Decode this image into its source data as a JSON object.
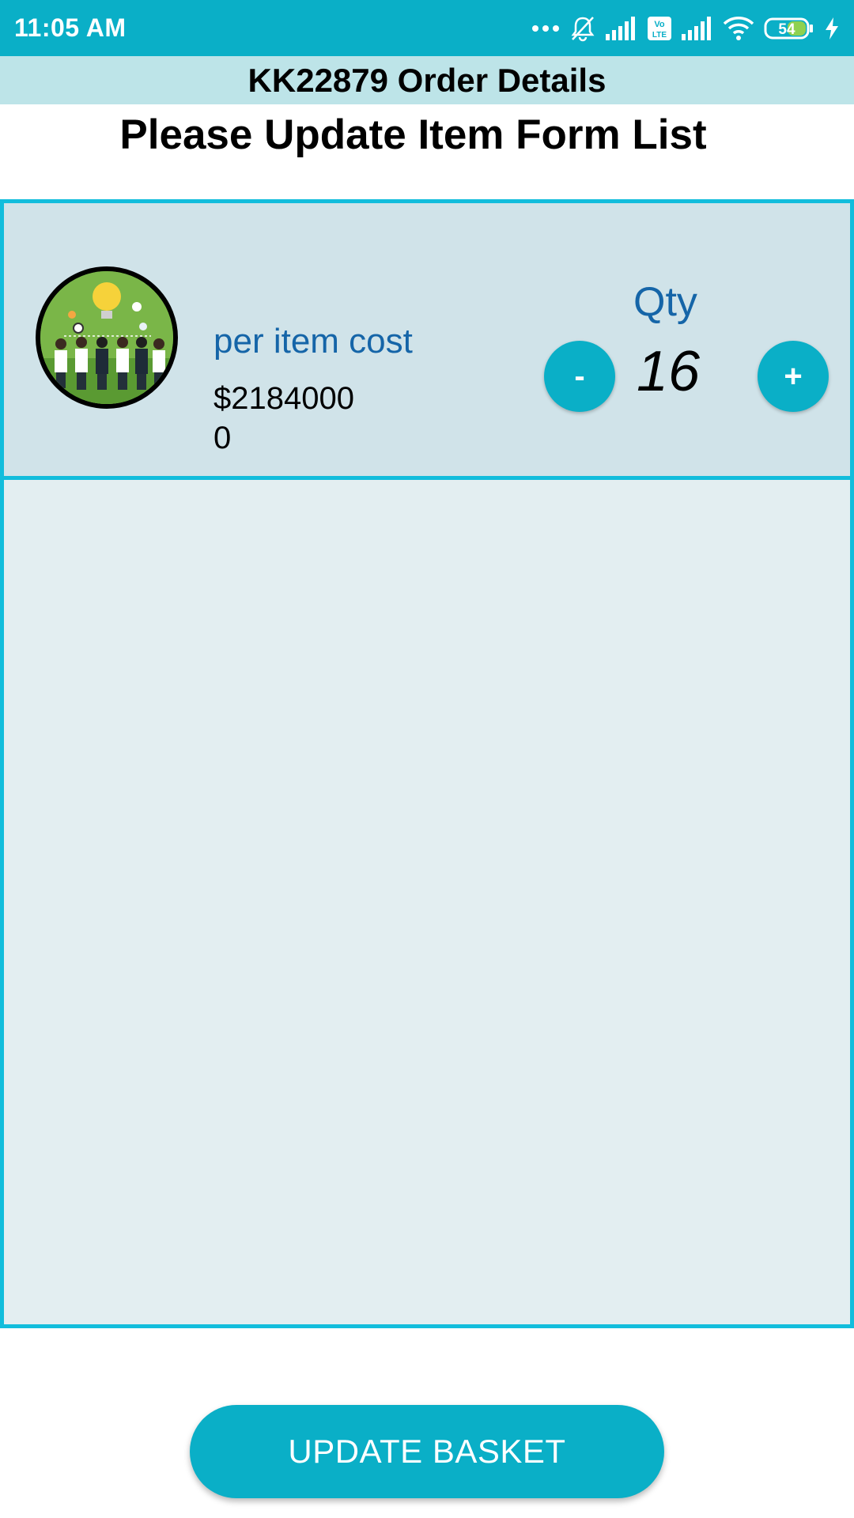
{
  "status_bar": {
    "time": "11:05 AM",
    "battery": "54",
    "icons": [
      "more-dots-icon",
      "bell-muted-icon",
      "signal-icon",
      "volte-icon",
      "signal-icon",
      "wifi-icon",
      "battery-icon",
      "charging-icon"
    ]
  },
  "header": {
    "title": "KK22879 Order Details"
  },
  "page": {
    "heading": "Please Update Item Form List"
  },
  "items": [
    {
      "cost_label": "per item cost",
      "cost_value": "$21840000",
      "qty_label": "Qty",
      "qty": "16",
      "minus_label": "-",
      "plus_label": "+"
    }
  ],
  "footer": {
    "update_label": "UPDATE BASKET"
  },
  "colors": {
    "accent": "#0aafc7",
    "border": "#12bddc",
    "title_bg": "#bde4e8",
    "row_bg": "#d0e3e9",
    "list_bg": "#e3eef1",
    "label_blue": "#1565a8"
  }
}
